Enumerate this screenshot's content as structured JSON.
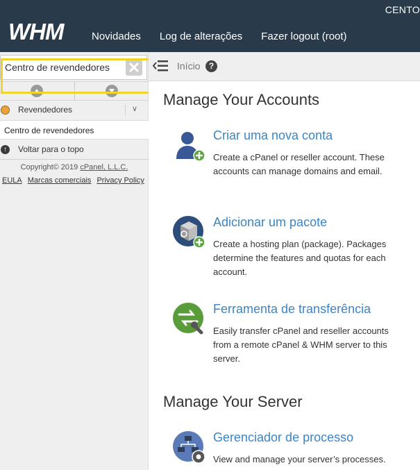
{
  "header": {
    "top_right_text": "CENTO",
    "logo_text": "WHM",
    "nav": [
      "Novidades",
      "Log de alterações",
      "Fazer logout (root)"
    ]
  },
  "sidebar": {
    "search_value": "Centro de revendedores",
    "category_label": "Revendedores",
    "category_chevron": "∨",
    "sub_item": "Centro de revendedores",
    "back_to_top": "Voltar para o topo",
    "copyright_prefix": "Copyright© 2019 ",
    "copyright_link": "cPanel, L.L.C.",
    "footer_links": [
      "EULA",
      "Marcas comerciais",
      "Privacy Policy"
    ]
  },
  "breadcrumb": {
    "home": "Início",
    "help": "?"
  },
  "main": {
    "section1_title": "Manage Your Accounts",
    "section2_title": "Manage Your Server",
    "features": [
      {
        "title": "Criar uma nova conta",
        "description": "Create a cPanel or reseller account. These accounts can manage domains and email."
      },
      {
        "title": "Adicionar um pacote",
        "description": "Create a hosting plan (package). Packages determine the features and quotas for each account."
      },
      {
        "title": "Ferramenta de transferência",
        "description": "Easily transfer cPanel and reseller accounts from a remote cPanel & WHM server to this server."
      },
      {
        "title": "Gerenciador de processo",
        "description": "View and manage your server’s processes."
      }
    ]
  },
  "colors": {
    "header_bg": "#293a4a",
    "link_blue": "#3d84c3",
    "highlight": "#f0d32c",
    "sidebar_bg": "#efefef"
  }
}
